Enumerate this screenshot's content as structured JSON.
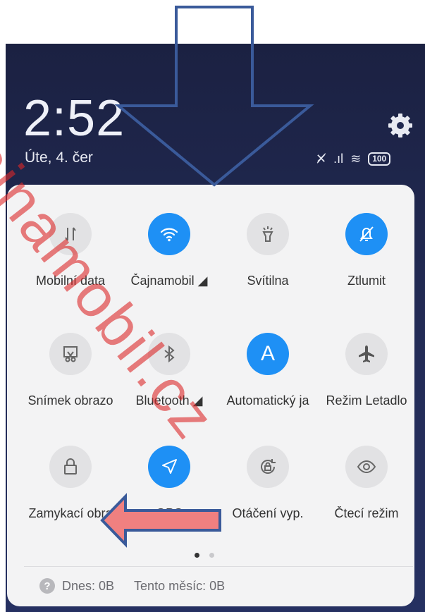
{
  "status": {
    "time": "2:52",
    "date": "Úte, 4. čer",
    "battery": "100"
  },
  "tiles": [
    {
      "label": "Mobilní data",
      "icon": "mobile-data-icon",
      "active": false
    },
    {
      "label": "Čajnamobil ◢",
      "icon": "wifi-icon",
      "active": true
    },
    {
      "label": "Svítilna",
      "icon": "flashlight-icon",
      "active": false
    },
    {
      "label": "Ztlumit",
      "icon": "mute-bell-icon",
      "active": true
    },
    {
      "label": "Snímek obrazo",
      "icon": "screenshot-icon",
      "active": false
    },
    {
      "label": "Bluetooth ◢",
      "icon": "bluetooth-icon",
      "active": false
    },
    {
      "label": "Automatický ja",
      "icon": "auto-brightness-icon",
      "active": true
    },
    {
      "label": "Režim Letadlo",
      "icon": "airplane-icon",
      "active": false
    },
    {
      "label": "Zamykací obra",
      "icon": "lock-icon",
      "active": false
    },
    {
      "label": "GPS",
      "icon": "location-arrow-icon",
      "active": true
    },
    {
      "label": "Otáčení vyp.",
      "icon": "rotation-lock-icon",
      "active": false
    },
    {
      "label": "Čtecí režim",
      "icon": "eye-icon",
      "active": false
    }
  ],
  "usage": {
    "today": "Dnes: 0B",
    "month": "Tento měsíc: 0B"
  },
  "watermark": "čajnamobil.cz",
  "colors": {
    "active": "#1e90f5",
    "arrow_fill": "#f08080",
    "arrow_stroke": "#3a5a9a"
  }
}
